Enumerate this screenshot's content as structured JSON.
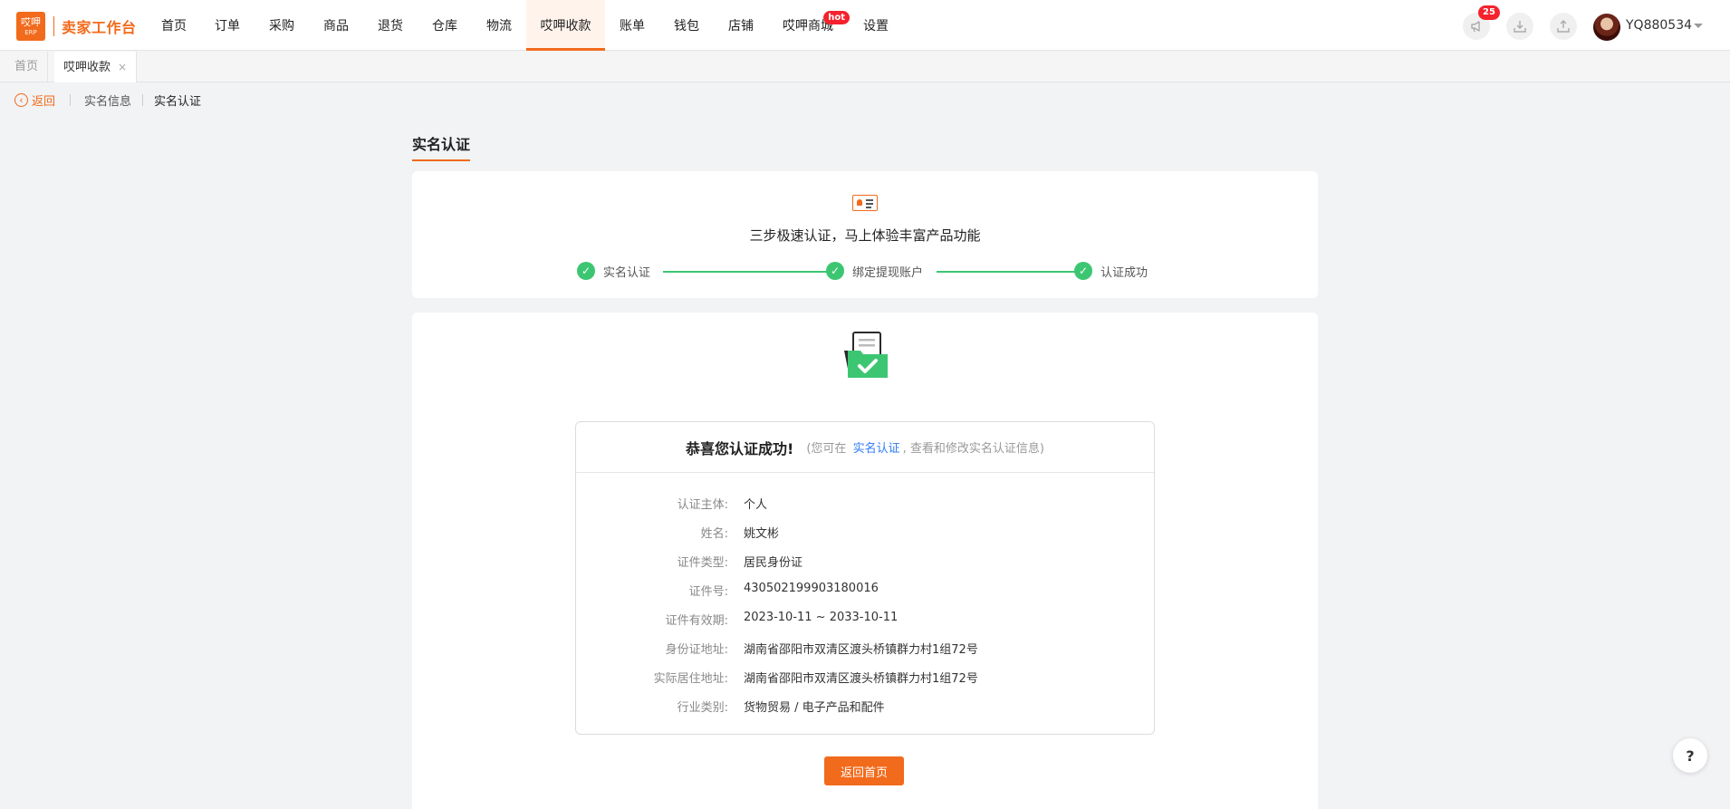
{
  "app": {
    "logo_top": "哎呷",
    "logo_bottom": "ERP",
    "title": "卖家工作台"
  },
  "nav": {
    "items": [
      {
        "label": "首页"
      },
      {
        "label": "订单"
      },
      {
        "label": "采购"
      },
      {
        "label": "商品"
      },
      {
        "label": "退货"
      },
      {
        "label": "仓库"
      },
      {
        "label": "物流"
      },
      {
        "label": "哎呷收款",
        "active": true
      },
      {
        "label": "账单"
      },
      {
        "label": "钱包"
      },
      {
        "label": "店铺"
      },
      {
        "label": "哎呷商城",
        "badge": "hot"
      },
      {
        "label": "设置"
      }
    ],
    "notifications_count": "25",
    "username": "YQ880534"
  },
  "tabs": [
    {
      "label": "首页",
      "active": false
    },
    {
      "label": "哎呷收款",
      "active": true,
      "close": "×"
    }
  ],
  "breadcrumb": {
    "back_label": "返回",
    "items": [
      "实名信息",
      "实名认证"
    ]
  },
  "section_title": "实名认证",
  "steps": {
    "heading": "三步极速认证，马上体验丰富产品功能",
    "items": [
      {
        "label": "实名认证",
        "done": true
      },
      {
        "label": "绑定提现账户",
        "done": true
      },
      {
        "label": "认证成功",
        "done": true
      }
    ]
  },
  "result": {
    "title": "恭喜您认证成功!",
    "hint_prefix": "(您可在",
    "hint_link": "实名认证",
    "hint_suffix": ", 查看和修改实名认证信息)",
    "fields": [
      {
        "label": "认证主体:",
        "value": "个人"
      },
      {
        "label": "姓名:",
        "value": "姚文彬"
      },
      {
        "label": "证件类型:",
        "value": "居民身份证"
      },
      {
        "label": "证件号:",
        "value": "430502199903180016"
      },
      {
        "label": "证件有效期:",
        "value": "2023-10-11 ~ 2033-10-11"
      },
      {
        "label": "身份证地址:",
        "value": "湖南省邵阳市双清区渡头桥镇群力村1组72号"
      },
      {
        "label": "实际居住地址:",
        "value": "湖南省邵阳市双清区渡头桥镇群力村1组72号"
      },
      {
        "label": "行业类别:",
        "value": "货物贸易 / 电子产品和配件"
      }
    ],
    "home_button": "返回首页"
  },
  "help_label": "?",
  "colors": {
    "brand": "#f26a1b",
    "success": "#3dc672",
    "link": "#2f7cf6",
    "badge": "#f5222d"
  }
}
